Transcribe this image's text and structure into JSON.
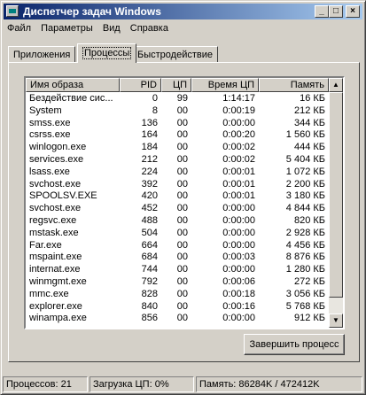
{
  "window": {
    "title": "Диспетчер задач Windows"
  },
  "titlebar_buttons": {
    "minimize": "_",
    "maximize": "□",
    "close": "×"
  },
  "menu": [
    "Файл",
    "Параметры",
    "Вид",
    "Справка"
  ],
  "tabs": [
    "Приложения",
    "Процессы",
    "Быстродействие"
  ],
  "active_tab": "Процессы",
  "columns": [
    "Имя образа",
    "PID",
    "ЦП",
    "Время ЦП",
    "Память"
  ],
  "processes": [
    [
      "Бездействие сис...",
      "0",
      "99",
      "1:14:17",
      "16 КБ"
    ],
    [
      "System",
      "8",
      "00",
      "0:00:19",
      "212 КБ"
    ],
    [
      "smss.exe",
      "136",
      "00",
      "0:00:00",
      "344 КБ"
    ],
    [
      "csrss.exe",
      "164",
      "00",
      "0:00:20",
      "1 560 КБ"
    ],
    [
      "winlogon.exe",
      "184",
      "00",
      "0:00:02",
      "444 КБ"
    ],
    [
      "services.exe",
      "212",
      "00",
      "0:00:02",
      "5 404 КБ"
    ],
    [
      "lsass.exe",
      "224",
      "00",
      "0:00:01",
      "1 072 КБ"
    ],
    [
      "svchost.exe",
      "392",
      "00",
      "0:00:01",
      "2 200 КБ"
    ],
    [
      "SPOOLSV.EXE",
      "420",
      "00",
      "0:00:01",
      "3 180 КБ"
    ],
    [
      "svchost.exe",
      "452",
      "00",
      "0:00:00",
      "4 844 КБ"
    ],
    [
      "regsvc.exe",
      "488",
      "00",
      "0:00:00",
      "820 КБ"
    ],
    [
      "mstask.exe",
      "504",
      "00",
      "0:00:00",
      "2 928 КБ"
    ],
    [
      "Far.exe",
      "664",
      "00",
      "0:00:00",
      "4 456 КБ"
    ],
    [
      "mspaint.exe",
      "684",
      "00",
      "0:00:03",
      "8 876 КБ"
    ],
    [
      "internat.exe",
      "744",
      "00",
      "0:00:00",
      "1 280 КБ"
    ],
    [
      "winmgmt.exe",
      "792",
      "00",
      "0:00:06",
      "272 КБ"
    ],
    [
      "mmc.exe",
      "828",
      "00",
      "0:00:18",
      "3 056 КБ"
    ],
    [
      "explorer.exe",
      "840",
      "00",
      "0:00:16",
      "5 768 КБ"
    ],
    [
      "winampa.exe",
      "856",
      "00",
      "0:00:00",
      "912 КБ"
    ]
  ],
  "end_process_button": "Завершить процесс",
  "status": {
    "processes": "Процессов: 21",
    "cpu": "Загрузка ЦП: 0%",
    "memory": "Память: 86284K / 472412K"
  },
  "colors": {
    "titlebar_start": "#0a246a",
    "titlebar_end": "#a6caf0",
    "face": "#d4d0c8"
  }
}
